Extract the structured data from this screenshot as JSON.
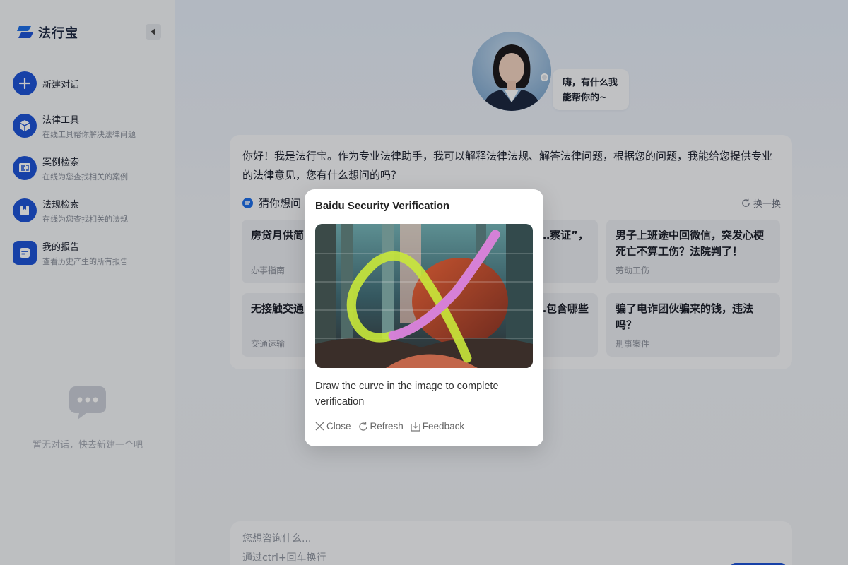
{
  "app": {
    "name": "法行宝"
  },
  "sidebar": {
    "new_chat": "新建对话",
    "items": [
      {
        "title": "法律工具",
        "sub": "在线工具帮你解决法律问题"
      },
      {
        "title": "案例检索",
        "sub": "在线为您查找相关的案例"
      },
      {
        "title": "法规检索",
        "sub": "在线为您查找相关的法规"
      },
      {
        "title": "我的报告",
        "sub": "查看历史产生的所有报告"
      }
    ],
    "empty_text": "暂无对话，快去新建一个吧"
  },
  "main": {
    "greeting": "嗨，有什么我能帮你的~",
    "intro": "你好！我是法行宝。作为专业法律助手，我可以解释法律法规、解答法律问题，根据您的问题，我能给您提供专业的法律意见，您有什么想问的吗？",
    "guess_label": "猜你想问",
    "swap_label": "换一换",
    "questions": [
      {
        "title": "房贷月供简…",
        "tag": "办事指南"
      },
      {
        "title": "…察证”，",
        "tag": ""
      },
      {
        "title": "男子上班途中回微信，突发心梗死亡不算工伤？法院判了！",
        "tag": "劳动工伤"
      },
      {
        "title": "无接触交通…分？",
        "tag": "交通运输"
      },
      {
        "title": "…包含哪些",
        "tag": ""
      },
      {
        "title": "骗了电诈团伙骗来的钱，违法吗？",
        "tag": "刑事案件"
      }
    ],
    "input_placeholder": "您想咨询什么...",
    "input_hint": "通过ctrl+回车换行"
  },
  "modal": {
    "title": "Baidu Security Verification",
    "instruction": "Draw the curve in the image to complete verification",
    "close": "Close",
    "refresh": "Refresh",
    "feedback": "Feedback"
  },
  "colors": {
    "accent": "#1e54d6",
    "bg": "#eef1f6",
    "card": "#f7f8fa"
  },
  "icons": [
    "logo-icon",
    "collapse-icon",
    "plus-icon",
    "cube-icon",
    "case-icon",
    "book-icon",
    "report-icon",
    "chat-bubble-icon",
    "guess-icon",
    "refresh-icon",
    "close-icon",
    "feedback-icon"
  ]
}
